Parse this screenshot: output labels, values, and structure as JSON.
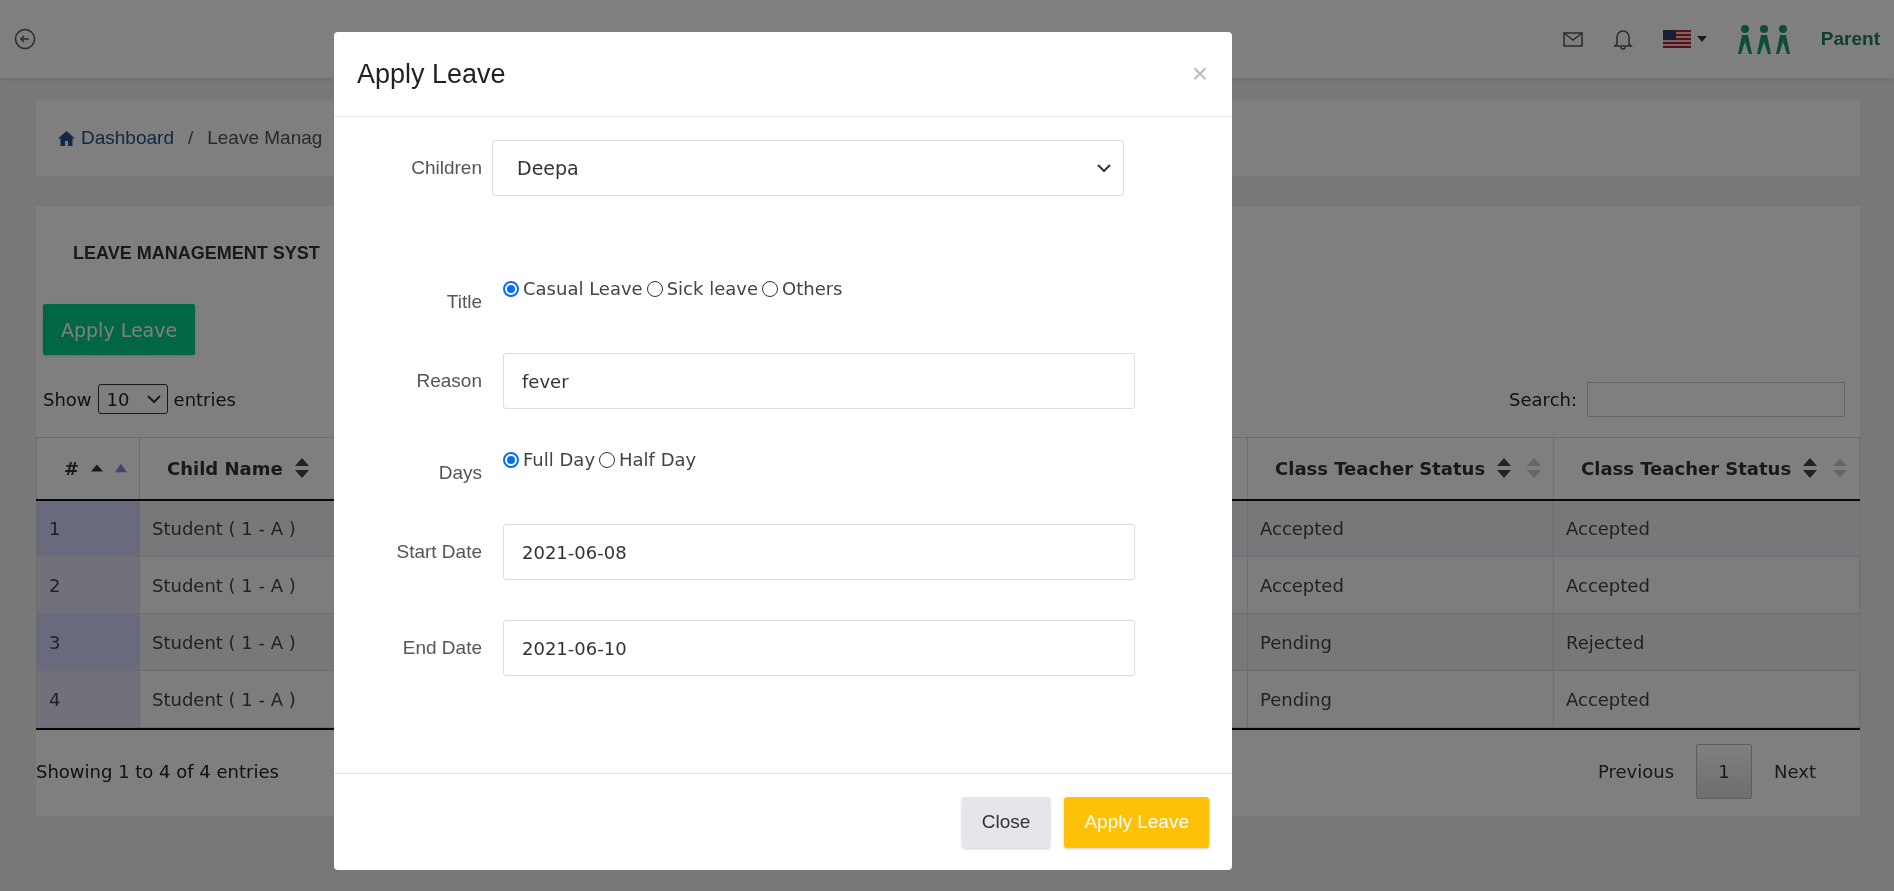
{
  "topbar": {
    "user_name": "Parent"
  },
  "breadcrumb": {
    "items": [
      {
        "label": "Dashboard"
      },
      {
        "label": "Leave Manag"
      }
    ],
    "separator": "/"
  },
  "panel": {
    "heading": "LEAVE MANAGEMENT SYST",
    "apply_button": "Apply Leave",
    "length": {
      "show": "Show",
      "value": "10",
      "entries": "entries"
    },
    "search_label": "Search:",
    "columns": [
      {
        "label": "#",
        "sorted": true
      },
      {
        "label": "Child Name",
        "sorted": false
      },
      {
        "label": "Class Teacher Status",
        "sorted": false
      },
      {
        "label": "Class Teacher Status",
        "sorted": false
      }
    ],
    "rows": [
      {
        "number": "1",
        "child": "Student ( 1 - A )",
        "status_1": "Accepted",
        "status_2": "Accepted"
      },
      {
        "number": "2",
        "child": "Student ( 1 - A )",
        "status_1": "Accepted",
        "status_2": "Accepted"
      },
      {
        "number": "3",
        "child": "Student ( 1 - A )",
        "status_1": "Pending",
        "status_2": "Rejected"
      },
      {
        "number": "4",
        "child": "Student ( 1 - A )",
        "status_1": "Pending",
        "status_2": "Accepted"
      }
    ],
    "info": "Showing 1 to 4 of 4 entries",
    "pagination": {
      "previous": "Previous",
      "pages": [
        {
          "label": "1",
          "selected": true
        }
      ],
      "next": "Next"
    }
  },
  "modal": {
    "title": "Apply Leave",
    "close": "×",
    "fields": [
      {
        "kind": "select",
        "label": "Children",
        "value": "Deepa"
      },
      {
        "kind": "radio",
        "label": "Title",
        "options": [
          {
            "label": "Casual Leave",
            "selected": true
          },
          {
            "label": "Sick leave",
            "selected": false
          },
          {
            "label": "Others",
            "selected": false
          }
        ]
      },
      {
        "kind": "text",
        "label": "Reason",
        "value": "fever"
      },
      {
        "kind": "radio",
        "label": "Days",
        "options": [
          {
            "label": "Full Day",
            "selected": true
          },
          {
            "label": "Half Day",
            "selected": false
          }
        ]
      },
      {
        "kind": "text",
        "label": "Start Date",
        "value": "2021-06-08"
      },
      {
        "kind": "text",
        "label": "End Date",
        "value": "2021-06-10"
      }
    ],
    "buttons": [
      {
        "label": "Close",
        "kind": "secondary"
      },
      {
        "label": "Apply Leave",
        "kind": "primary"
      }
    ]
  }
}
